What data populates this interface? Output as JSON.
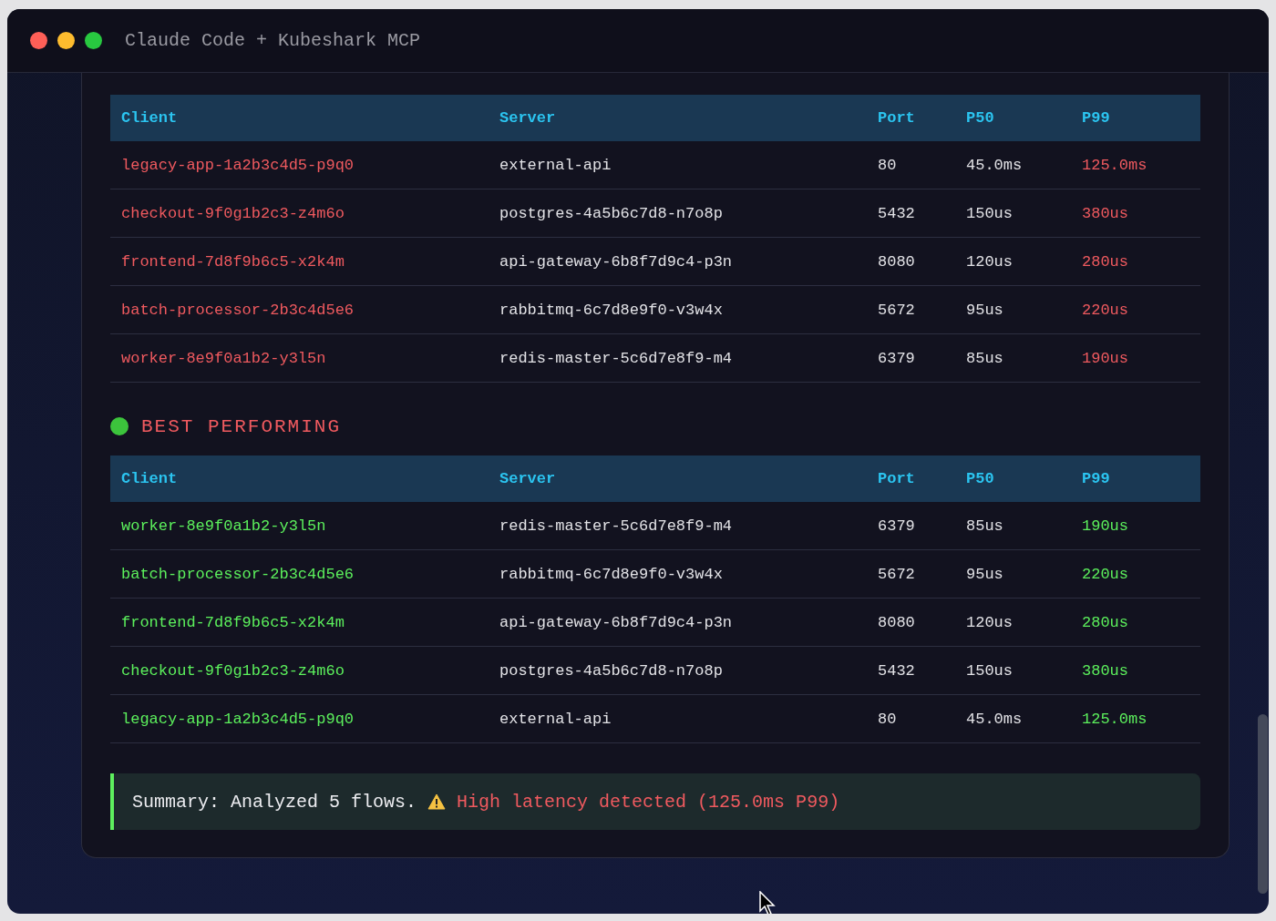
{
  "window": {
    "title": "Claude Code + Kubeshark MCP"
  },
  "tables": [
    {
      "kind": "worst",
      "columns": [
        "Client",
        "Server",
        "Port",
        "P50",
        "P99"
      ],
      "rows": [
        {
          "client": "legacy-app-1a2b3c4d5-p9q0",
          "server": "external-api",
          "port": "80",
          "p50": "45.0ms",
          "p99": "125.0ms"
        },
        {
          "client": "checkout-9f0g1b2c3-z4m6o",
          "server": "postgres-4a5b6c7d8-n7o8p",
          "port": "5432",
          "p50": "150us",
          "p99": "380us"
        },
        {
          "client": "frontend-7d8f9b6c5-x2k4m",
          "server": "api-gateway-6b8f7d9c4-p3n",
          "port": "8080",
          "p50": "120us",
          "p99": "280us"
        },
        {
          "client": "batch-processor-2b3c4d5e6",
          "server": "rabbitmq-6c7d8e9f0-v3w4x",
          "port": "5672",
          "p50": "95us",
          "p99": "220us"
        },
        {
          "client": "worker-8e9f0a1b2-y3l5n",
          "server": "redis-master-5c6d7e8f9-m4",
          "port": "6379",
          "p50": "85us",
          "p99": "190us"
        }
      ]
    },
    {
      "kind": "best",
      "heading": {
        "text": "BEST PERFORMING",
        "color": "#3cc43c"
      },
      "columns": [
        "Client",
        "Server",
        "Port",
        "P50",
        "P99"
      ],
      "rows": [
        {
          "client": "worker-8e9f0a1b2-y3l5n",
          "server": "redis-master-5c6d7e8f9-m4",
          "port": "6379",
          "p50": "85us",
          "p99": "190us"
        },
        {
          "client": "batch-processor-2b3c4d5e6",
          "server": "rabbitmq-6c7d8e9f0-v3w4x",
          "port": "5672",
          "p50": "95us",
          "p99": "220us"
        },
        {
          "client": "frontend-7d8f9b6c5-x2k4m",
          "server": "api-gateway-6b8f7d9c4-p3n",
          "port": "8080",
          "p50": "120us",
          "p99": "280us"
        },
        {
          "client": "checkout-9f0g1b2c3-z4m6o",
          "server": "postgres-4a5b6c7d8-n7o8p",
          "port": "5432",
          "p50": "150us",
          "p99": "380us"
        },
        {
          "client": "legacy-app-1a2b3c4d5-p9q0",
          "server": "external-api",
          "port": "80",
          "p50": "45.0ms",
          "p99": "125.0ms"
        }
      ]
    }
  ],
  "summary": {
    "text": "Summary: Analyzed 5 flows.",
    "alert": "High latency detected (125.0ms P99)"
  }
}
